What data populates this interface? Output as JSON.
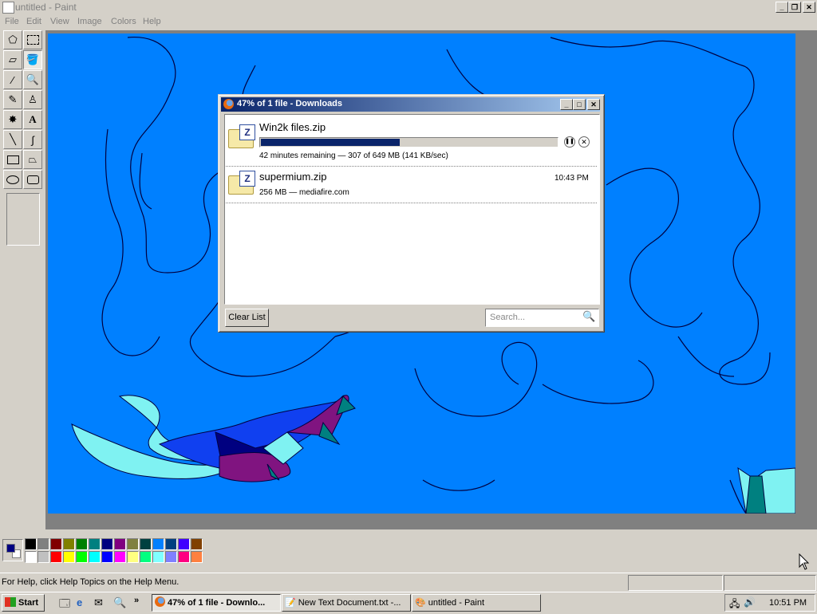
{
  "paint": {
    "title": "untitled - Paint",
    "menu": [
      "File",
      "Edit",
      "View",
      "Image",
      "Colors",
      "Help"
    ],
    "status_help": "For Help, click Help Topics on the Help Menu.",
    "colors": {
      "canvas": "#0080ff",
      "primary": "#000080",
      "secondary": "#ffffff",
      "palette_top": [
        "#000000",
        "#808080",
        "#800000",
        "#808000",
        "#008000",
        "#008080",
        "#000080",
        "#800080",
        "#808040",
        "#004040",
        "#0080ff",
        "#004080",
        "#4000ff",
        "#804000"
      ],
      "palette_bottom": [
        "#ffffff",
        "#c0c0c0",
        "#ff0000",
        "#ffff00",
        "#00ff00",
        "#00ffff",
        "#0000ff",
        "#ff00ff",
        "#ffff80",
        "#00ff80",
        "#80ffff",
        "#8080ff",
        "#ff0080",
        "#ff8040"
      ]
    },
    "tools": [
      "free-select",
      "rect-select",
      "eraser",
      "fill",
      "color-picker",
      "magnifier",
      "pencil",
      "brush",
      "airbrush",
      "text",
      "line",
      "curve",
      "rectangle",
      "polygon",
      "ellipse",
      "rounded-rect"
    ]
  },
  "downloads": {
    "title": "47% of 1 file - Downloads",
    "items": [
      {
        "name": "Win2k files.zip",
        "status": "42 minutes remaining — 307 of 649 MB (141 KB/sec)",
        "progress": 0.47
      },
      {
        "name": "supermium.zip",
        "status": "256 MB — mediafire.com",
        "time": "10:43 PM"
      }
    ],
    "clear_label": "Clear List",
    "search_placeholder": "Search..."
  },
  "taskbar": {
    "start": "Start",
    "windows": [
      "47% of 1 file - Downlo...",
      "New Text Document.txt -...",
      "untitled - Paint"
    ],
    "clock": "10:51 PM"
  }
}
